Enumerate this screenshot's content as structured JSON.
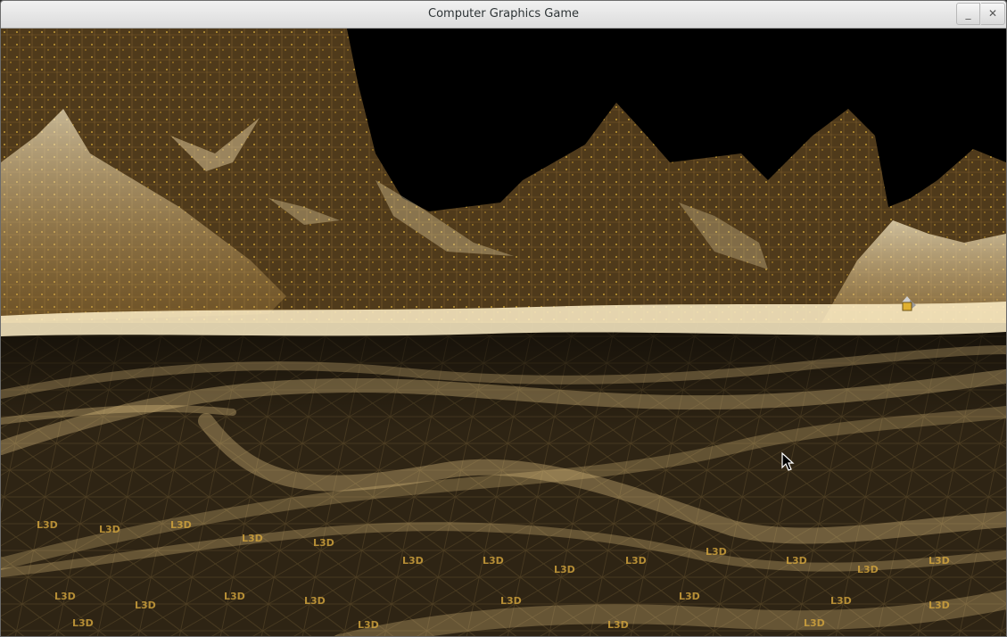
{
  "window": {
    "title": "Computer Graphics Game",
    "minimize_glyph": "_",
    "close_glyph": "✕"
  },
  "scene": {
    "ground_texture_label": "L3D",
    "sky_color": "#000000",
    "terrain_color": "#5a4320",
    "highlight_color": "#f2d08a",
    "icons": [
      "navigation-gizmo-icon",
      "mouse-cursor-icon"
    ]
  }
}
